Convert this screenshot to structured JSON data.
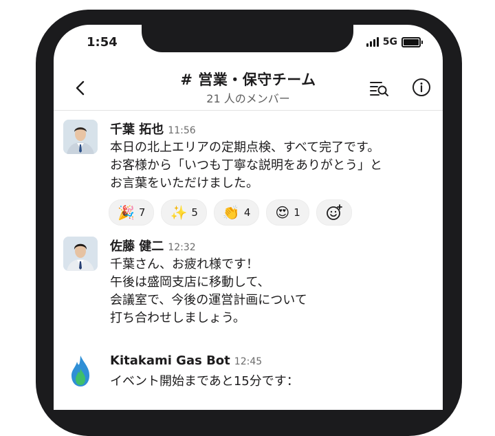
{
  "status_bar": {
    "time": "1:54",
    "network": "5G"
  },
  "channel": {
    "title": "# 営業・保守チーム",
    "members": "21 人のメンバー"
  },
  "messages": [
    {
      "author": "千葉 拓也",
      "time": "11:56",
      "lines": [
        "本日の北上エリアの定期点検、すべて完了です。",
        "お客様から「いつも丁寧な説明をありがとう」と",
        "お言葉をいただけました。"
      ],
      "reactions": [
        {
          "emoji": "🎉",
          "count": "7"
        },
        {
          "emoji": "✨",
          "count": "5"
        },
        {
          "emoji": "👏",
          "count": "4"
        },
        {
          "emoji": "😍",
          "count": "1"
        }
      ]
    },
    {
      "author": "佐藤 健二",
      "time": "12:32",
      "lines": [
        "千葉さん、お疲れ様です！",
        "午後は盛岡支店に移動して、",
        "会議室で、今後の運営計画について",
        "打ち合わせしましょう。"
      ]
    },
    {
      "author": "Kitakami Gas Bot",
      "time": "12:45",
      "lines": [
        "イベント開始まであと15分です："
      ]
    }
  ],
  "colors": {
    "frame": "#1b1b1d",
    "bot_flame_outer": "#2f8fd6",
    "bot_flame_inner": "#3fbf6a"
  },
  "icons": [
    "back-chevron-icon",
    "search-threads-icon",
    "info-icon",
    "add-reaction-icon"
  ]
}
